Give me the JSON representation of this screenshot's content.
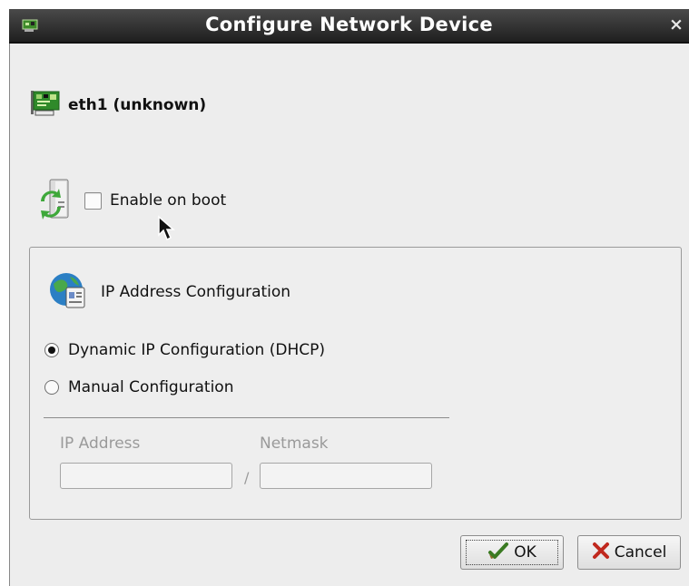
{
  "window": {
    "title": "Configure Network Device",
    "close_glyph": "×",
    "title_icon": "network-card-icon"
  },
  "device": {
    "icon": "network-card-icon",
    "label": "eth1 (unknown)"
  },
  "boot": {
    "icon": "server-refresh-icon",
    "label": "Enable on boot",
    "checked": false
  },
  "ip_config": {
    "icon": "globe-id-card-icon",
    "title": "IP Address Configuration",
    "options": [
      {
        "label": "Dynamic IP Configuration (DHCP)",
        "selected": true
      },
      {
        "label": "Manual Configuration",
        "selected": false
      }
    ],
    "ip_label": "IP Address",
    "netmask_label": "Netmask",
    "ip_value": "",
    "netmask_value": "",
    "separator": "/"
  },
  "buttons": {
    "ok_label": "OK",
    "ok_icon": "check-icon",
    "cancel_label": "Cancel",
    "cancel_icon": "cross-icon"
  },
  "colors": {
    "titlebar": "#2a2a2a",
    "window_bg": "#ededed",
    "disabled_text": "#9a9a9a"
  }
}
